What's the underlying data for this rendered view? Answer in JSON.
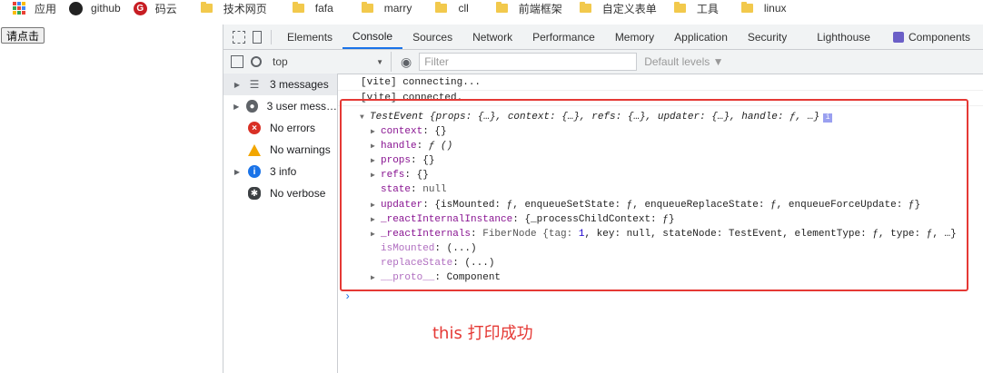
{
  "bookmarks": [
    {
      "label": "应用",
      "icon": "apps-grid-icon"
    },
    {
      "label": "github",
      "icon": "github-icon"
    },
    {
      "label": "码云",
      "icon": "gitee-icon"
    },
    {
      "label": "技术网页",
      "icon": "folder-icon"
    },
    {
      "label": "fafa",
      "icon": "folder-icon"
    },
    {
      "label": "marry",
      "icon": "folder-icon"
    },
    {
      "label": "cll",
      "icon": "folder-icon"
    },
    {
      "label": "前端框架",
      "icon": "folder-icon"
    },
    {
      "label": "自定义表单",
      "icon": "folder-icon"
    },
    {
      "label": "工具",
      "icon": "folder-icon"
    },
    {
      "label": "linux",
      "icon": "folder-icon"
    }
  ],
  "page": {
    "button_label": "请点击"
  },
  "devtools": {
    "tabs": [
      "Elements",
      "Console",
      "Sources",
      "Network",
      "Performance",
      "Memory",
      "Application",
      "Security",
      "Lighthouse",
      "Components"
    ],
    "active_tab": "Console",
    "context": "top",
    "filter_placeholder": "Filter",
    "levels_label": "Default levels ▼",
    "sidebar": [
      {
        "label": "3 messages",
        "icon": "list-icon",
        "expandable": true
      },
      {
        "label": "3 user mess…",
        "icon": "user-icon",
        "expandable": true
      },
      {
        "label": "No errors",
        "icon": "error-icon",
        "expandable": false
      },
      {
        "label": "No warnings",
        "icon": "warning-icon",
        "expandable": false
      },
      {
        "label": "3 info",
        "icon": "info-icon",
        "expandable": true
      },
      {
        "label": "No verbose",
        "icon": "bug-icon",
        "expandable": false
      }
    ],
    "console": {
      "line1": "[vite] connecting...",
      "line2": "[vite] connected.",
      "object_head": "TestEvent {props: {…}, context: {…}, refs: {…}, updater: {…}, handle: ƒ, …}",
      "rows": {
        "context": {
          "key": "context",
          "val": "{}"
        },
        "handle": {
          "key": "handle",
          "val": "ƒ ()"
        },
        "props": {
          "key": "props",
          "val": "{}"
        },
        "refs": {
          "key": "refs",
          "val": "{}"
        },
        "state": {
          "key": "state",
          "val": "null"
        },
        "updater": {
          "key": "updater",
          "val": "{isMounted: ƒ, enqueueSetState: ƒ, enqueueReplaceState: ƒ, enqueueForceUpdate: ƒ}"
        },
        "rii": {
          "key": "_reactInternalInstance",
          "val": "{_processChildContext: ƒ}"
        },
        "ri_key": "_reactInternals",
        "ri_pre": "FiberNode {tag: ",
        "ri_num": "1",
        "ri_post": ", key: null, stateNode: TestEvent, elementType: ƒ, type: ƒ, …}",
        "isMounted": {
          "key": "isMounted",
          "val": "(...)"
        },
        "replaceState": {
          "key": "replaceState",
          "val": "(...)"
        },
        "proto": {
          "key": "__proto__",
          "val": "Component"
        }
      },
      "prompt": "›"
    }
  },
  "annotation": "this 打印成功",
  "colors": {
    "highlight_box": "#e53935",
    "tab_accent": "#1a73e8"
  }
}
